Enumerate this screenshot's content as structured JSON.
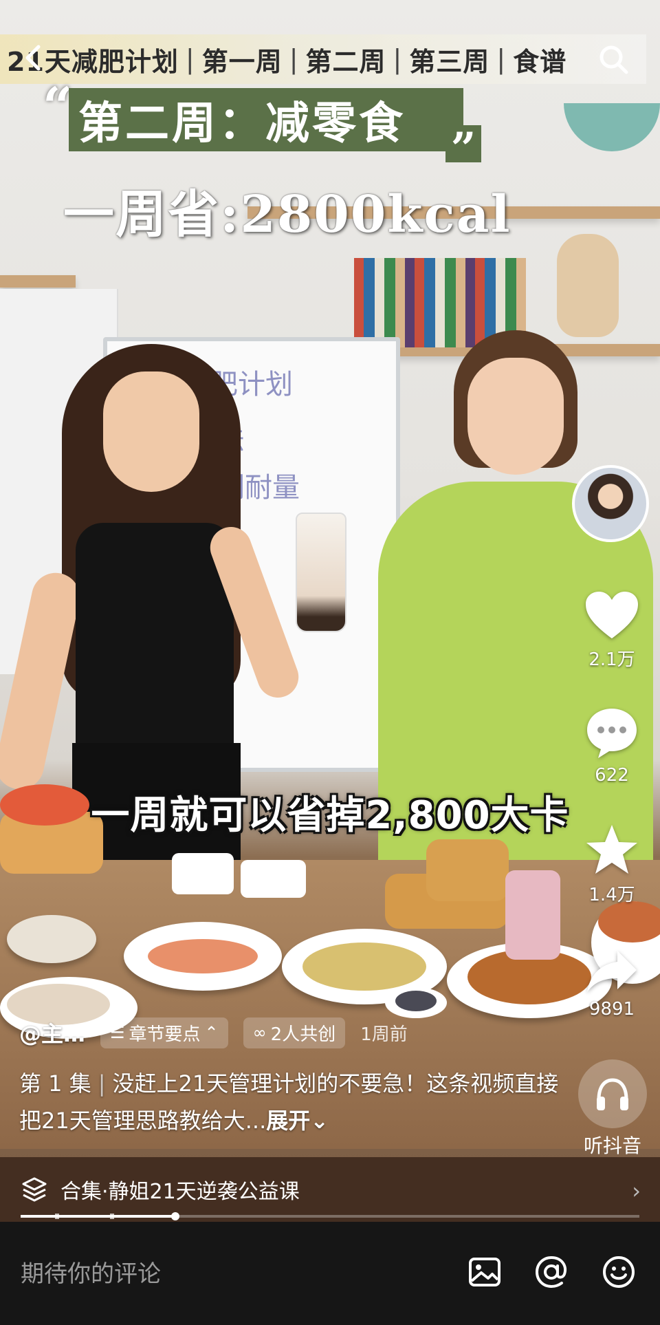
{
  "top_bar": {
    "week_tabs": [
      "21天减肥计划",
      "第一周",
      "第二周",
      "第三周",
      "食谱"
    ],
    "separator": "|"
  },
  "overlay": {
    "quote_open": "“",
    "title": "第二周：减零食",
    "quote_close": "”",
    "savings": "一周省:2800kcal"
  },
  "subtitle": "一周就可以省掉2,800大卡",
  "right_rail": {
    "like_count": "2.1万",
    "comment_count": "622",
    "favorite_count": "1.4万",
    "share_count": "9891"
  },
  "meta": {
    "author": "@主…",
    "chapter_label": "章节要点",
    "cocreate_label": "2人共创",
    "time_ago": "1周前"
  },
  "description": {
    "episode": "第 1 集",
    "text": "没赶上21天管理计划的不要急！这条视频直接把21天管理思路教给大...",
    "expand": "展开"
  },
  "listen": {
    "label": "听抖音"
  },
  "collection": {
    "label": "合集·静姐21天逆袭公益课"
  },
  "progress": {
    "value": 0.25
  },
  "comment_bar": {
    "placeholder": "期待你的评论"
  },
  "icons": [
    "back-icon",
    "search-icon",
    "heart-icon",
    "comment-icon",
    "star-icon",
    "share-icon",
    "headphones-icon",
    "layers-icon",
    "chevron-right-icon",
    "image-icon",
    "at-icon",
    "emoji-icon"
  ]
}
